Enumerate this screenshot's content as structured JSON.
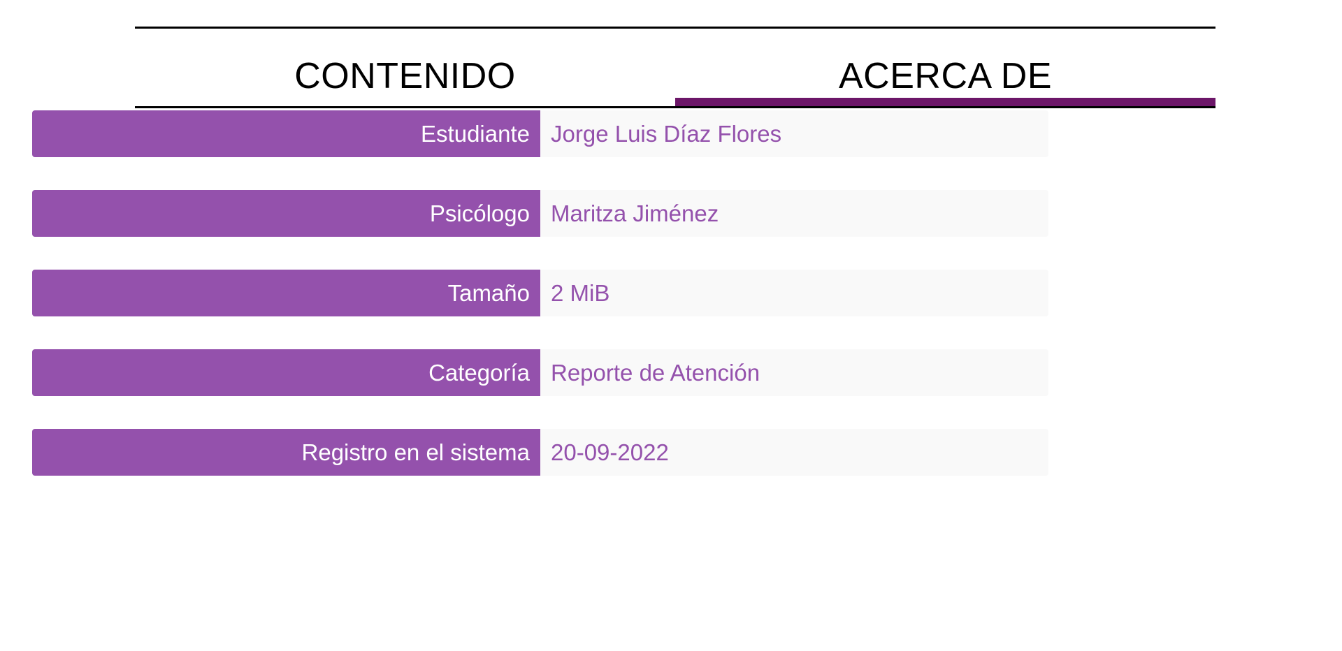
{
  "tabs": [
    {
      "label": "CONTENIDO",
      "active": false
    },
    {
      "label": "ACERCA DE",
      "active": true
    }
  ],
  "details": [
    {
      "label": "Estudiante",
      "value": "Jorge Luis Díaz Flores"
    },
    {
      "label": "Psicólogo",
      "value": "Maritza Jiménez"
    },
    {
      "label": "Tamaño",
      "value": "2 MiB"
    },
    {
      "label": "Categoría",
      "value": "Reporte de Atención"
    },
    {
      "label": "Registro en el sistema",
      "value": "20-09-2022"
    }
  ],
  "colors": {
    "accent": "#9451ac",
    "active_tab_underline": "#6c1668",
    "value_background": "#f9f9f9"
  }
}
